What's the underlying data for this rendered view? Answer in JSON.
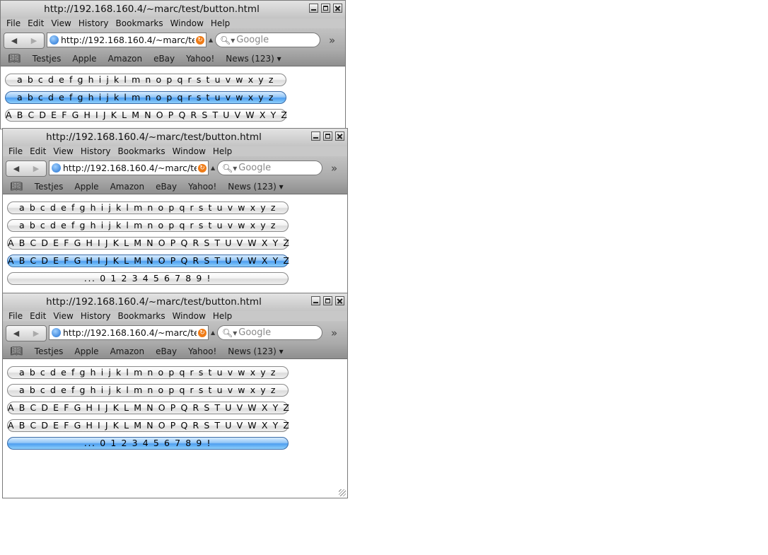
{
  "windows": [
    {
      "title": "http://192.168.160.4/~marc/test/button.html",
      "menu": [
        "File",
        "Edit",
        "View",
        "History",
        "Bookmarks",
        "Window",
        "Help"
      ],
      "url": "http://192.168.160.4/~marc/te",
      "search_placeholder": "Google",
      "bookmarks": [
        "Testjes",
        "Apple",
        "Amazon",
        "eBay",
        "Yahoo!",
        "News (123) ▾"
      ],
      "buttons": [
        {
          "label": "a b c d e f g h i j k l m n o p q r s t u v w x y z",
          "selected": false
        },
        {
          "label": "a b c d e f g h i j k l m n o p q r s t u v w x y z",
          "selected": true
        },
        {
          "label": "A B C D E F G H I J K L M N O P Q R S T U V  W X Y Z",
          "selected": false
        }
      ]
    },
    {
      "title": "http://192.168.160.4/~marc/test/button.html",
      "menu": [
        "File",
        "Edit",
        "View",
        "History",
        "Bookmarks",
        "Window",
        "Help"
      ],
      "url": "http://192.168.160.4/~marc/te",
      "search_placeholder": "Google",
      "bookmarks": [
        "Testjes",
        "Apple",
        "Amazon",
        "eBay",
        "Yahoo!",
        "News (123) ▾"
      ],
      "buttons": [
        {
          "label": "a b c d e f g h i j k l m n o p q r s t u v w x y z",
          "selected": false
        },
        {
          "label": "a b c d e f g h i j k l m n o p q r s t u v w x y z",
          "selected": false
        },
        {
          "label": "A B C D E F G H I J K L M N O P Q R S T U V  W X Y Z",
          "selected": false
        },
        {
          "label": "A B C D E F G H I J K L M N O P Q R S T U V  W X Y Z",
          "selected": true
        },
        {
          "label": "... 0 1 2 3 4 5 6 7 8 9 !",
          "selected": false
        }
      ]
    },
    {
      "title": "http://192.168.160.4/~marc/test/button.html",
      "menu": [
        "File",
        "Edit",
        "View",
        "History",
        "Bookmarks",
        "Window",
        "Help"
      ],
      "url": "http://192.168.160.4/~marc/te",
      "search_placeholder": "Google",
      "bookmarks": [
        "Testjes",
        "Apple",
        "Amazon",
        "eBay",
        "Yahoo!",
        "News (123) ▾"
      ],
      "buttons": [
        {
          "label": "a b c d e f g h i j k l m n o p q r s t u v w x y z",
          "selected": false
        },
        {
          "label": "a b c d e f g h i j k l m n o p q r s t u v w x y z",
          "selected": false
        },
        {
          "label": "A B C D E F G H I J K L M N O P Q R S T U V  W X Y Z",
          "selected": false
        },
        {
          "label": "A B C D E F G H I J K L M N O P Q R S T U V  W X Y Z",
          "selected": false
        },
        {
          "label": "... 0 1 2 3 4 5 6 7 8 9 !",
          "selected": true
        }
      ]
    }
  ],
  "icons": {
    "back": "back-arrow-icon",
    "forward": "forward-arrow-icon",
    "globe": "globe-icon",
    "reload": "reload-icon",
    "search": "magnifier-icon",
    "overflow": "chevron-double-right-icon",
    "bookmarks": "open-book-icon",
    "resize": "resize-grip-icon"
  },
  "colors": {
    "selected_button": "#4d9ef0",
    "chrome": "#c4c4c4"
  }
}
